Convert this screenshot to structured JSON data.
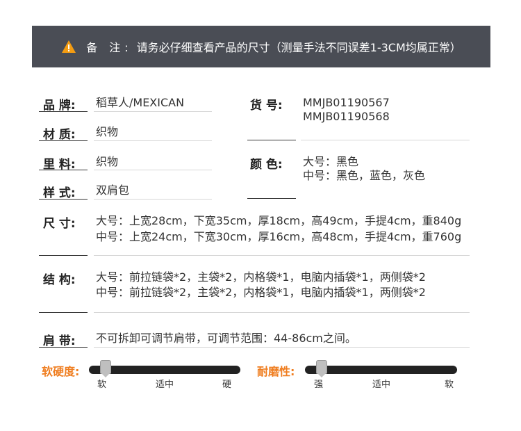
{
  "note": {
    "label": "备 注:",
    "text": "请务必仔细查看产品的尺寸（测量手法不同误差1-3CM均属正常）"
  },
  "specs": {
    "brand": {
      "label": "品 牌:",
      "value": "稻草人/MEXICAN"
    },
    "item_no": {
      "label": "货 号:",
      "values": [
        "MMJB01190567",
        "MMJB01190568"
      ]
    },
    "material": {
      "label": "材 质:",
      "value": "织物"
    },
    "lining": {
      "label": "里 料:",
      "value": "织物"
    },
    "color": {
      "label": "颜 色:",
      "values": [
        "大号：黑色",
        "中号：黑色，蓝色，灰色"
      ]
    },
    "style": {
      "label": "样 式:",
      "value": "双肩包"
    },
    "size": {
      "label": "尺 寸:",
      "values": [
        "大号：上宽28cm，下宽35cm，厚18cm，高49cm，手提4cm，重840g",
        "中号：上宽24cm，下宽30cm，厚16cm，高48cm，手提4cm，重760g"
      ]
    },
    "structure": {
      "label": "结 构:",
      "values": [
        "大号：前拉链袋*2，主袋*2，内格袋*1，电脑内插袋*1，两侧袋*2",
        "中号：前拉链袋*2，主袋*2，内格袋*1，电脑内插袋*1，两侧袋*2"
      ]
    },
    "strap": {
      "label": "肩 带:",
      "value": "不可拆卸可调节肩带，可调节范围：44-86cm之间。"
    }
  },
  "sliders": {
    "softness": {
      "label": "软硬度:",
      "ticks": [
        "软",
        "适中",
        "硬"
      ],
      "level": 0.05
    },
    "durability": {
      "label": "耐磨性:",
      "ticks": [
        "强",
        "适中",
        "软"
      ],
      "level": 0.05
    }
  },
  "colors": {
    "banner_bg": "#4a4d55",
    "accent": "#ef7d1f",
    "warning": "#f39c12"
  }
}
